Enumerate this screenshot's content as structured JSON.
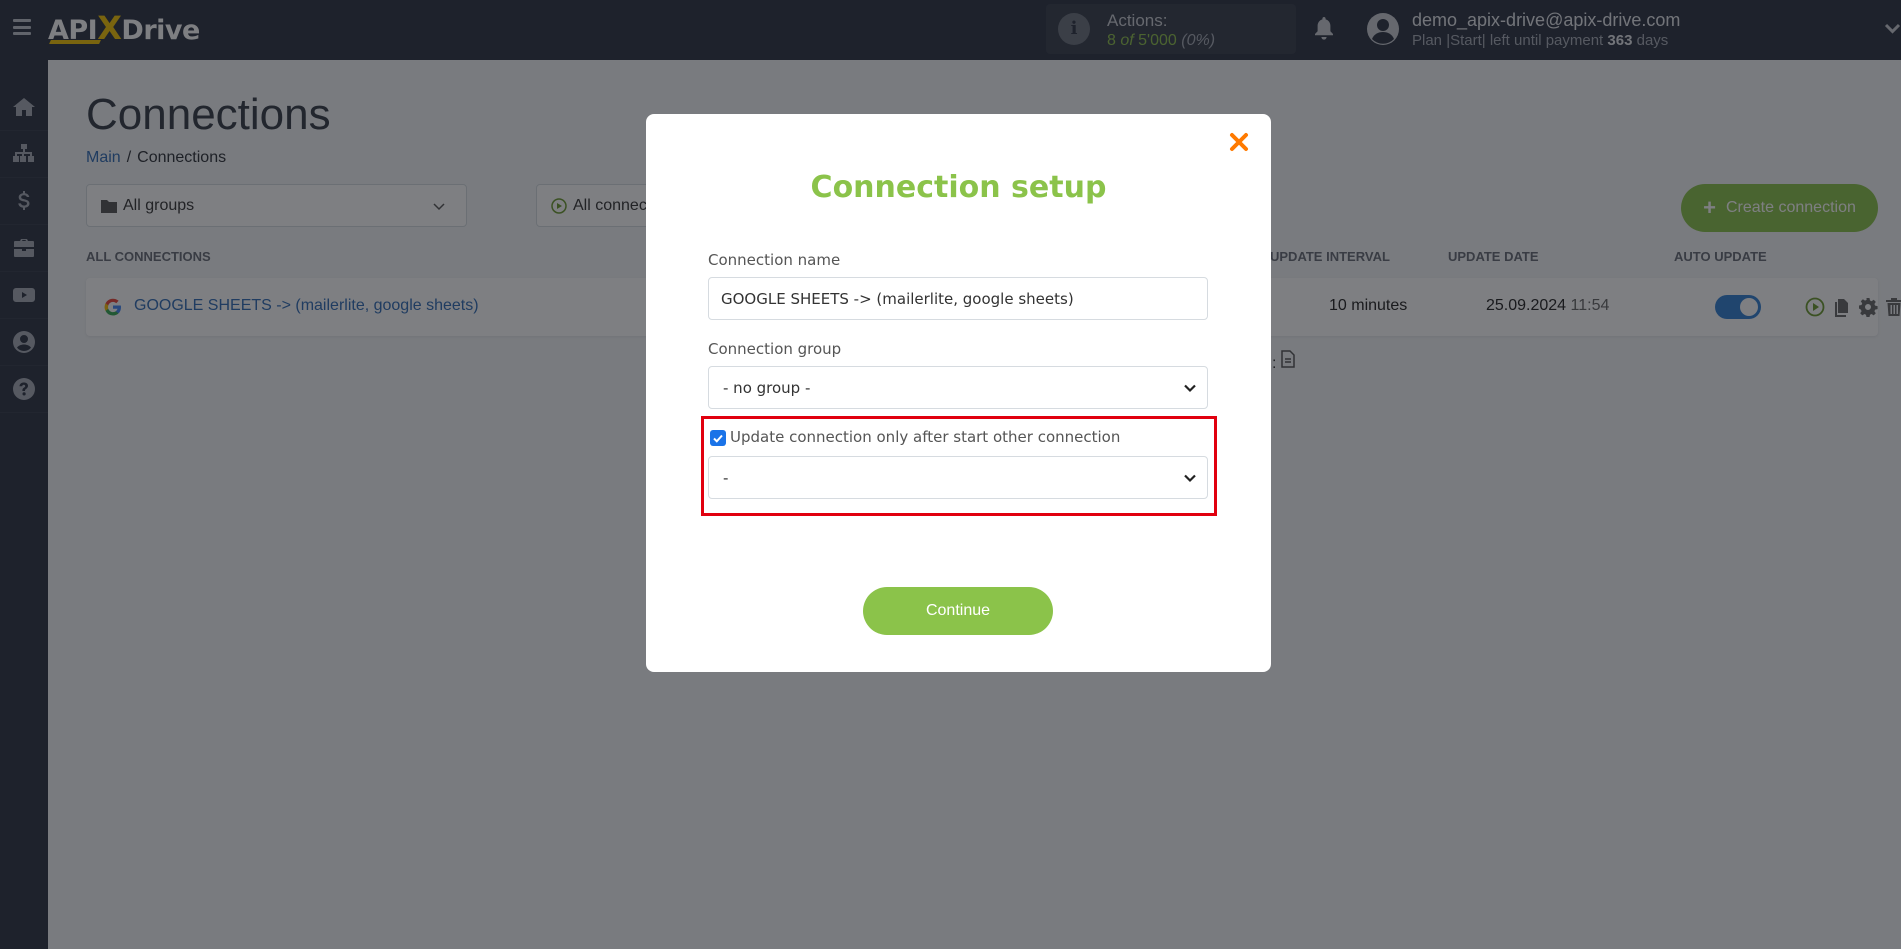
{
  "header": {
    "logo": {
      "part1": "API",
      "x": "X",
      "part2": "Drive"
    },
    "actions": {
      "label": "Actions:",
      "used": "8",
      "of": "of",
      "total": "5'000",
      "percent": "(0%)"
    },
    "user": {
      "email": "demo_apix-drive@apix-drive.com",
      "plan_prefix": "Plan |Start| left until payment",
      "days": "363",
      "days_suffix": "days"
    }
  },
  "sidebar": {
    "items": [
      {
        "icon": "home-icon"
      },
      {
        "icon": "sitemap-icon"
      },
      {
        "icon": "dollar-icon"
      },
      {
        "icon": "briefcase-icon"
      },
      {
        "icon": "youtube-icon"
      },
      {
        "icon": "user-circle-icon"
      },
      {
        "icon": "help-icon"
      }
    ]
  },
  "page": {
    "title": "Connections",
    "breadcrumb": {
      "main": "Main",
      "sep": "/",
      "current": "Connections"
    },
    "filters": {
      "groups": "All groups",
      "status": "All connections"
    },
    "create_button": "Create connection",
    "columns": {
      "all": "ALL CONNECTIONS",
      "interval": "UPDATE INTERVAL",
      "date": "UPDATE DATE",
      "auto": "AUTO UPDATE"
    },
    "rows": [
      {
        "name": "GOOGLE SHEETS -> (mailerlite, google sheets)",
        "interval": "10 minutes",
        "date": "25.09.2024",
        "time": "11:54",
        "auto_update": true
      }
    ],
    "doc_hint": ":"
  },
  "modal": {
    "title": "Connection setup",
    "name_label": "Connection name",
    "name_value": "GOOGLE SHEETS -> (mailerlite, google sheets)",
    "group_label": "Connection group",
    "group_value": "- no group -",
    "dependency_checkbox_label": "Update connection only after start other connection",
    "dependency_checked": true,
    "dependency_value": "-",
    "continue_label": "Continue",
    "colors": {
      "accent": "#8bc34a",
      "close": "#ff7a00",
      "highlight": "#e1000f"
    }
  }
}
